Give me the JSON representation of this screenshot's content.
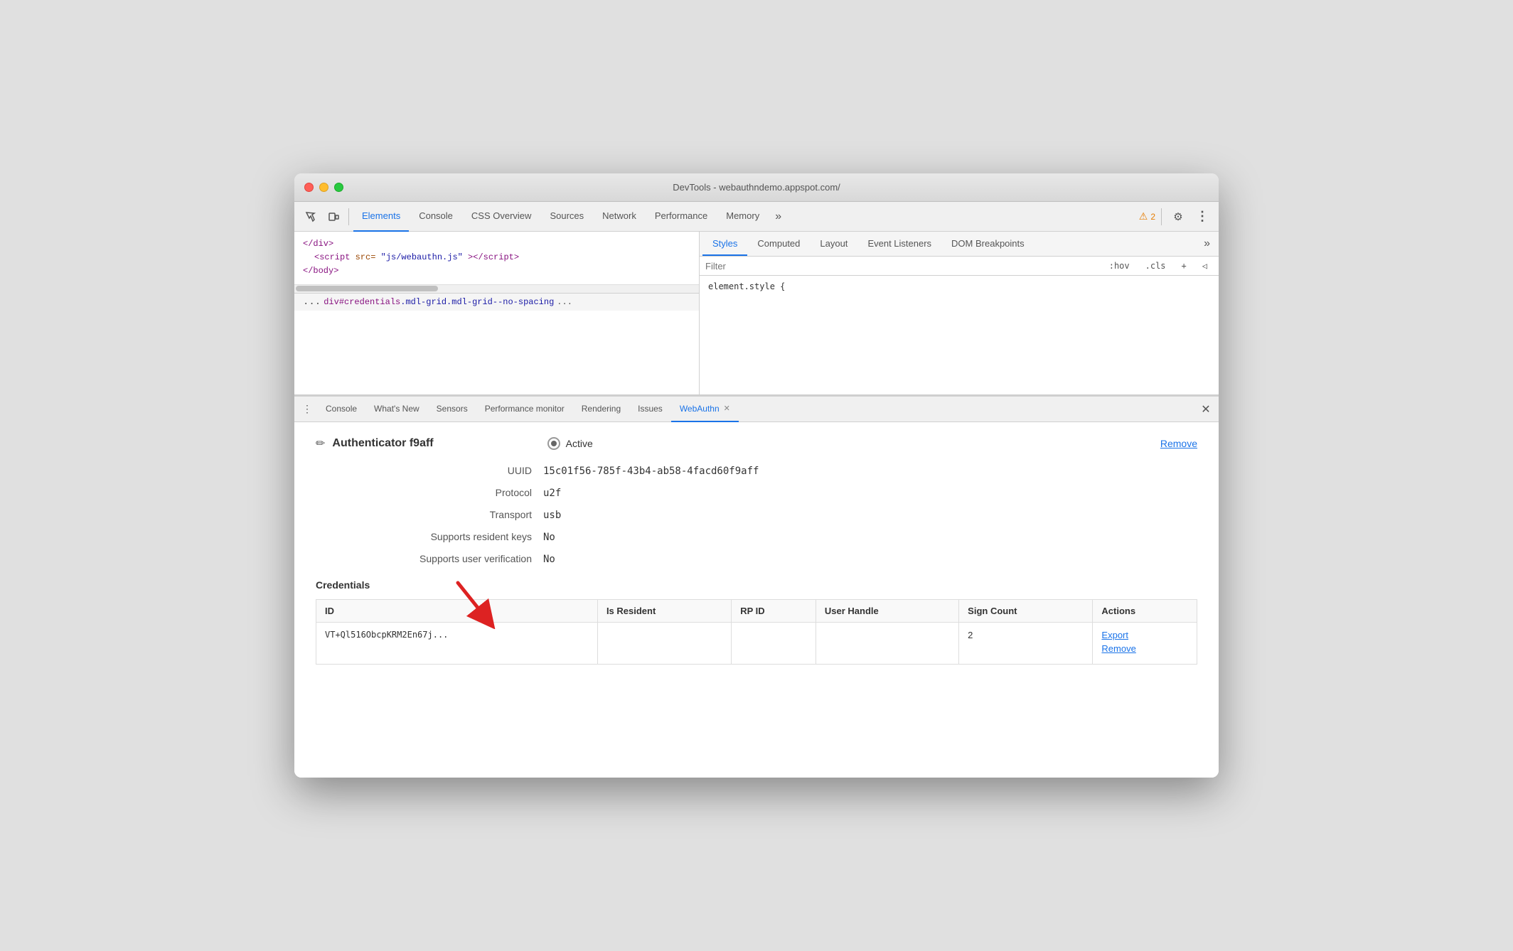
{
  "window": {
    "title": "DevTools - webauthndemo.appspot.com/"
  },
  "toolbar": {
    "tabs": [
      {
        "id": "elements",
        "label": "Elements",
        "active": true
      },
      {
        "id": "console",
        "label": "Console",
        "active": false
      },
      {
        "id": "css-overview",
        "label": "CSS Overview",
        "active": false
      },
      {
        "id": "sources",
        "label": "Sources",
        "active": false
      },
      {
        "id": "network",
        "label": "Network",
        "active": false
      },
      {
        "id": "performance",
        "label": "Performance",
        "active": false
      },
      {
        "id": "memory",
        "label": "Memory",
        "active": false
      }
    ],
    "overflow_label": "»",
    "warning_count": "2",
    "settings_icon": "⚙",
    "more_icon": "⋮"
  },
  "left_panel": {
    "lines": [
      {
        "indent": 0,
        "html": "&lt;/div&gt;"
      },
      {
        "indent": 1,
        "html": "&lt;script src=\"js/webauthn.js\"&gt;&lt;/script&gt;"
      },
      {
        "indent": 0,
        "html": "&lt;/body&gt;"
      }
    ],
    "breadcrumb": {
      "prefix": "...",
      "tag": "div#credentials",
      "classes": ".mdl-grid.mdl-grid--no-spacing",
      "more": "..."
    }
  },
  "styles_panel": {
    "tabs": [
      {
        "id": "styles",
        "label": "Styles",
        "active": true
      },
      {
        "id": "computed",
        "label": "Computed",
        "active": false
      },
      {
        "id": "layout",
        "label": "Layout",
        "active": false
      },
      {
        "id": "event-listeners",
        "label": "Event Listeners",
        "active": false
      },
      {
        "id": "dom-breakpoints",
        "label": "DOM Breakpoints",
        "active": false
      }
    ],
    "filter_placeholder": "Filter",
    "hover_btn": ":hov",
    "cls_btn": ".cls",
    "plus_btn": "+",
    "back_btn": "◁",
    "element_style": "element.style {"
  },
  "drawer": {
    "tabs": [
      {
        "id": "console",
        "label": "Console",
        "active": false
      },
      {
        "id": "whats-new",
        "label": "What's New",
        "active": false
      },
      {
        "id": "sensors",
        "label": "Sensors",
        "active": false
      },
      {
        "id": "performance-monitor",
        "label": "Performance monitor",
        "active": false
      },
      {
        "id": "rendering",
        "label": "Rendering",
        "active": false
      },
      {
        "id": "issues",
        "label": "Issues",
        "active": false
      },
      {
        "id": "webauthn",
        "label": "WebAuthn",
        "active": true,
        "closeable": true
      }
    ],
    "close_label": "✕"
  },
  "webauthn": {
    "edit_icon": "✏",
    "authenticator_name": "Authenticator f9aff",
    "active_label": "Active",
    "remove_link": "Remove",
    "uuid_label": "UUID",
    "uuid_value": "15c01f56-785f-43b4-ab58-4facd60f9aff",
    "protocol_label": "Protocol",
    "protocol_value": "u2f",
    "transport_label": "Transport",
    "transport_value": "usb",
    "resident_keys_label": "Supports resident keys",
    "resident_keys_value": "No",
    "user_verification_label": "Supports user verification",
    "user_verification_value": "No",
    "credentials_title": "Credentials",
    "table": {
      "columns": [
        {
          "id": "id",
          "label": "ID"
        },
        {
          "id": "is-resident",
          "label": "Is Resident"
        },
        {
          "id": "rp-id",
          "label": "RP ID"
        },
        {
          "id": "user-handle",
          "label": "User Handle"
        },
        {
          "id": "sign-count",
          "label": "Sign Count"
        },
        {
          "id": "actions",
          "label": "Actions"
        }
      ],
      "rows": [
        {
          "id": "VT+Ql516ObcpKRM2En67j...",
          "is_resident": "",
          "rp_id": "",
          "user_handle": "",
          "sign_count": "2",
          "actions": [
            "Export",
            "Remove"
          ]
        }
      ]
    }
  }
}
